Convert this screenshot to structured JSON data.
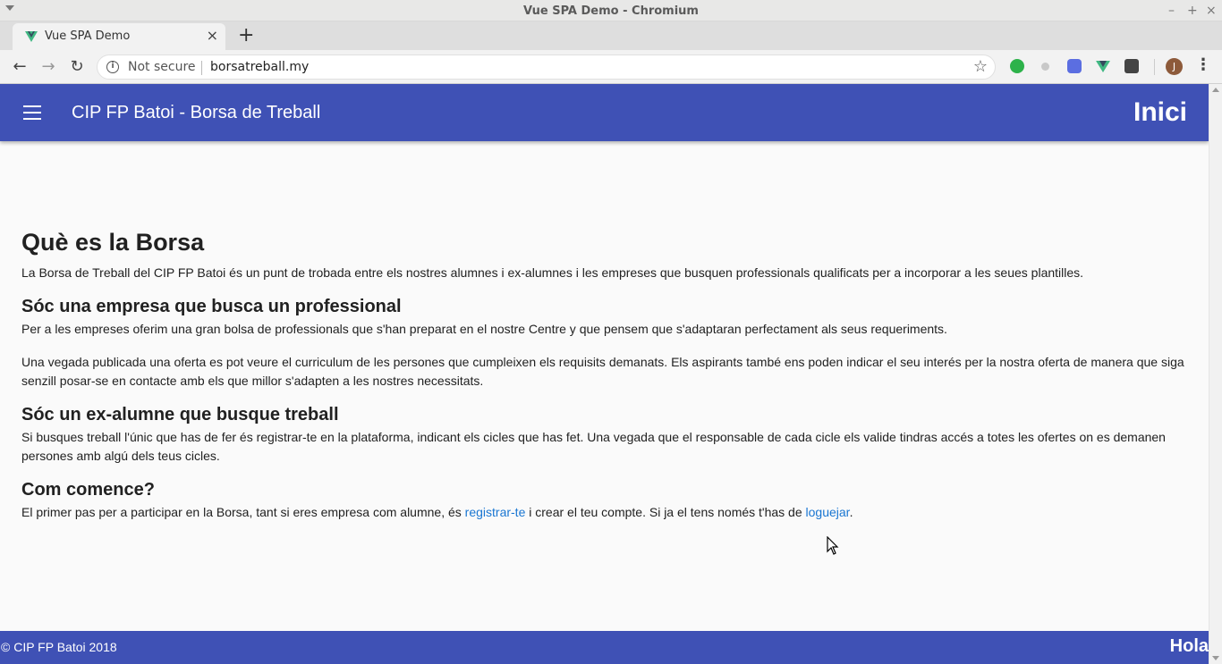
{
  "window": {
    "title": "Vue SPA Demo - Chromium",
    "controls": {
      "minimize": "–",
      "maximize": "+",
      "close": "×"
    }
  },
  "tabs": [
    {
      "title": "Vue SPA Demo",
      "active": true
    }
  ],
  "toolbar": {
    "security_label": "Not secure",
    "url": "borsatreball.my",
    "profile_initial": "J"
  },
  "app": {
    "brand_color": "#3f51b5",
    "title": "CIP FP Batoi - Borsa de Treball",
    "nav_right": "Inici"
  },
  "content": {
    "heading": "Què es la Borsa",
    "intro": "La Borsa de Treball del CIP FP Batoi és un punt de trobada entre els nostres alumnes i ex-alumnes i les empreses que busquen professionals qualificats per a incorporar a les seues plantilles.",
    "section_company": {
      "heading": "Sóc una empresa que busca un professional",
      "p1": "Per a les empreses oferim una gran bolsa de professionals que s'han preparat en el nostre Centre y que pensem que s'adaptaran perfectament als seus requeriments.",
      "p2": "Una vegada publicada una oferta es pot veure el curriculum de les persones que cumpleixen els requisits demanats. Els aspirants també ens poden indicar el seu interés per la nostra oferta de manera que siga senzill posar-se en contacte amb els que millor s'adapten a les nostres necessitats."
    },
    "section_student": {
      "heading": "Sóc un ex-alumne que busque treball",
      "p1": "Si busques treball l'únic que has de fer és registrar-te en la plataforma, indicant els cicles que has fet. Una vegada que el responsable de cada cicle els valide tindras accés a totes les ofertes on es demanen persones amb algú dels teus cicles."
    },
    "section_start": {
      "heading": "Com comence?",
      "text_before": "El primer pas per a participar en la Borsa, tant si eres empresa com alumne, és ",
      "link_register": "registrar-te",
      "text_middle": " i crear el teu compte. Si ja el tens només t'has de ",
      "link_login": "loguejar",
      "text_after": "."
    }
  },
  "footer": {
    "copyright": "© CIP FP Batoi 2018",
    "right": "Hola"
  }
}
